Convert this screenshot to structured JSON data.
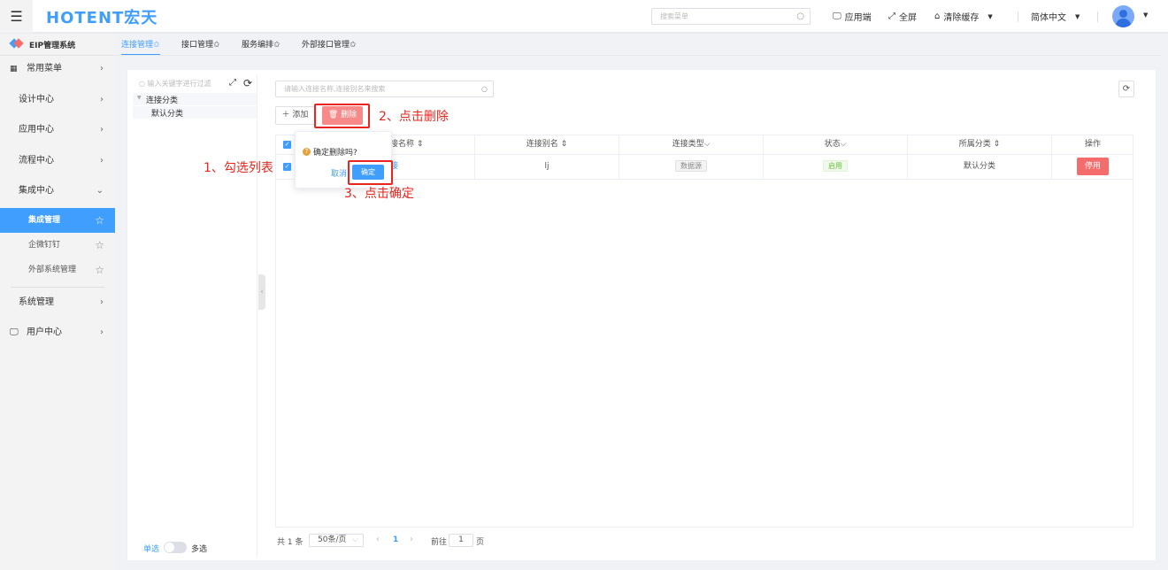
{
  "header": {
    "logo": "HOTENT宏天",
    "search_placeholder": "搜索菜单",
    "app_end": "应用端",
    "fullscreen": "全屏",
    "clear_cache": "清除缓存",
    "language": "简体中文"
  },
  "sidebar": {
    "system": "EIP管理系统",
    "items": [
      {
        "label": "常用菜单"
      },
      {
        "label": "设计中心"
      },
      {
        "label": "应用中心"
      },
      {
        "label": "流程中心"
      },
      {
        "label": "集成中心"
      },
      {
        "label": "集成管理"
      },
      {
        "label": "企微钉钉"
      },
      {
        "label": "外部系统管理"
      },
      {
        "label": "系统管理"
      },
      {
        "label": "用户中心"
      }
    ],
    "single": "单选",
    "multi": "多选"
  },
  "tabs": [
    "连接管理✩",
    "接口管理✩",
    "服务编排✩",
    "外部接口管理✩"
  ],
  "tree": {
    "filter_placeholder": "输入关键字进行过滤",
    "root": "连接分类",
    "child": "默认分类"
  },
  "toolbar": {
    "search_placeholder": "请输入连接名称,连接别名来搜索",
    "add": "添加",
    "delete": "删除"
  },
  "table": {
    "headers": [
      "连接名称 ⇕",
      "连接别名 ⇕",
      "连接类型⌵",
      "状态⌵",
      "所属分类 ⇕",
      "操作"
    ],
    "row": {
      "name": "连接",
      "alias": "lj",
      "type": "数据源",
      "status": "启用",
      "category": "默认分类",
      "action": "停用"
    }
  },
  "popover": {
    "message": "确定删除吗?",
    "cancel": "取消",
    "confirm": "确定"
  },
  "pagination": {
    "total": "共 1 条",
    "page_size": "50条/页",
    "current": "1",
    "goto": "前往",
    "goto_value": "1",
    "page_suffix": "页"
  },
  "annotations": {
    "step1": "1、勾选列表",
    "step2": "2、点击删除",
    "step3": "3、点击确定"
  },
  "colors": {
    "primary": "#409eff",
    "danger": "#f56c6c",
    "annotation": "#e8261e"
  }
}
